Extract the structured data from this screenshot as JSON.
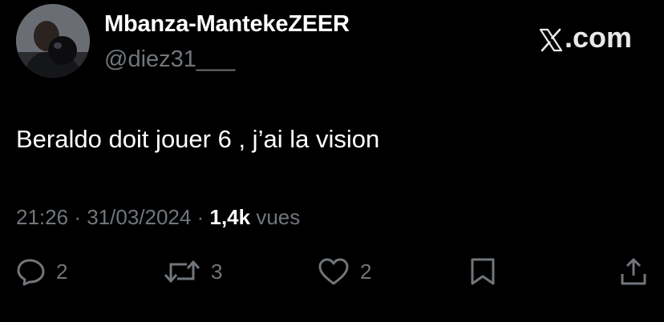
{
  "tweet": {
    "author": {
      "display_name": "Mbanza-MantekeZEER",
      "handle": "@diez31___",
      "avatar": "profile-photo"
    },
    "brand": {
      "icon": "x-logo-icon",
      "label": ".com"
    },
    "text": "Beraldo doit jouer 6 , j’ai la vision",
    "meta": {
      "time": "21:26",
      "separator": "·",
      "date": "31/03/2024",
      "views_count": "1,4k",
      "views_label": "vues"
    },
    "actions": {
      "reply": {
        "icon": "reply-icon",
        "count": "2"
      },
      "retweet": {
        "icon": "retweet-icon",
        "count": "3"
      },
      "like": {
        "icon": "heart-icon",
        "count": "2"
      },
      "bookmark": {
        "icon": "bookmark-icon"
      },
      "share": {
        "icon": "share-icon"
      }
    }
  },
  "colors": {
    "background": "#000000",
    "primary_text": "#ffffff",
    "secondary_text": "#71767b"
  }
}
